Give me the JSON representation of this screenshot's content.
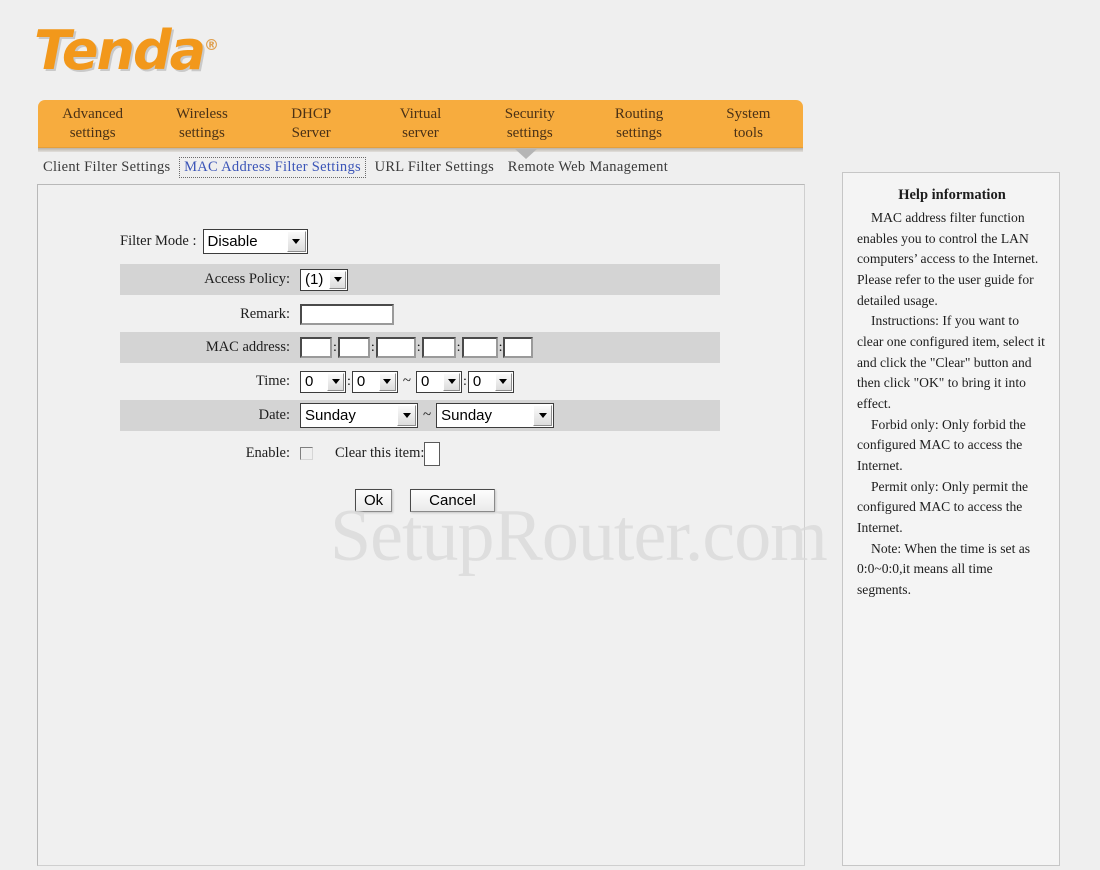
{
  "brand": {
    "name": "Tenda",
    "registered_mark": "®"
  },
  "watermark": "SetupRouter.com",
  "main_nav": [
    {
      "line1": "Advanced",
      "line2": "settings"
    },
    {
      "line1": "Wireless",
      "line2": "settings"
    },
    {
      "line1": "DHCP",
      "line2": "Server"
    },
    {
      "line1": "Virtual",
      "line2": "server"
    },
    {
      "line1": "Security",
      "line2": "settings"
    },
    {
      "line1": "Routing",
      "line2": "settings"
    },
    {
      "line1": "System",
      "line2": "tools"
    }
  ],
  "sub_nav": [
    {
      "label": "Client Filter Settings",
      "active": false
    },
    {
      "label": "MAC Address Filter Settings",
      "active": true
    },
    {
      "label": "URL Filter Settings",
      "active": false
    },
    {
      "label": "Remote Web Management",
      "active": false
    }
  ],
  "form": {
    "filter_mode": {
      "label": "Filter Mode :",
      "value": "Disable"
    },
    "access_policy": {
      "label": "Access Policy:",
      "value": "(1)"
    },
    "remark": {
      "label": "Remark:",
      "value": "",
      "placeholder": ""
    },
    "mac_address": {
      "label": "MAC address:",
      "octets": [
        "",
        "",
        "",
        "",
        "",
        ""
      ],
      "separator": ":"
    },
    "time": {
      "label": "Time:",
      "start_hour": "0",
      "start_minute": "0",
      "end_hour": "0",
      "end_minute": "0",
      "range_separator": "~",
      "time_separator": ":"
    },
    "date": {
      "label": "Date:",
      "start": "Sunday",
      "end": "Sunday",
      "range_separator": "~"
    },
    "enable": {
      "label": "Enable:",
      "checked": false,
      "clear_label": "Clear this item:"
    },
    "buttons": {
      "ok": "Ok",
      "cancel": "Cancel"
    }
  },
  "help": {
    "title": "Help information",
    "paragraphs": [
      "MAC address filter function enables you to control the LAN computers’ access to the Internet. Please refer to the user guide for detailed usage.",
      "Instructions: If you want to clear one configured item, select it and click the \"Clear\" button and then click \"OK\" to bring it into effect.",
      "Forbid only: Only forbid the configured MAC to access the Internet.",
      "Permit only: Only permit the configured MAC to access the Internet.",
      "Note: When the time is set as 0:0~0:0,it means all time segments."
    ]
  },
  "colors": {
    "brand_orange": "#f2981b",
    "nav_orange": "#f7ac3e",
    "page_background": "#efefef",
    "row_shaded": "#d4d4d4",
    "active_link": "#3b55b7"
  }
}
